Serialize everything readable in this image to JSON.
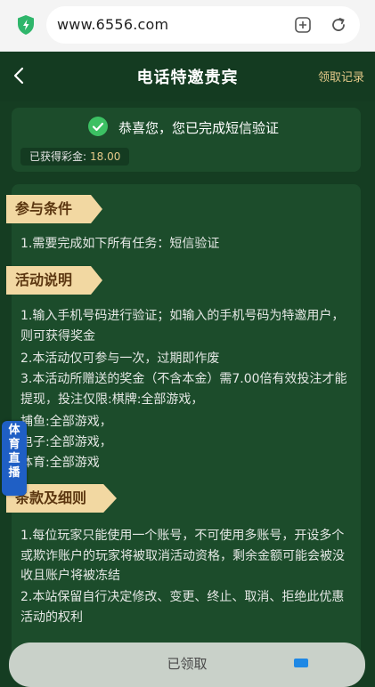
{
  "browser": {
    "url": "www.6556.com"
  },
  "header": {
    "title": "电话特邀贵宾",
    "records_link": "领取记录"
  },
  "success": {
    "message": "恭喜您，您已完成短信验证",
    "bonus_label": "已获得彩金:",
    "bonus_value": "18.00"
  },
  "sections": [
    {
      "title": "参与条件",
      "lines": [
        "1.需要完成如下所有任务：短信验证"
      ]
    },
    {
      "title": "活动说明",
      "lines": [
        "1.输入手机号码进行验证；如输入的手机号码为特邀用户，则可获得奖金",
        "2.本活动仅可参与一次，过期即作废",
        "3.本活动所赠送的奖金（不含本金）需7.00倍有效投注才能提现，投注仅限:棋牌:全部游戏，",
        "捕鱼:全部游戏，",
        "电子:全部游戏，",
        "体育:全部游戏"
      ]
    },
    {
      "title": "条款及细则",
      "lines": [
        "1.每位玩家只能使用一个账号，不可使用多账号，开设多个或欺诈账户的玩家将被取消活动资格，剩余金额可能会被没收且账户将被冻结",
        "2.本站保留自行决定修改、变更、终止、取消、拒绝此优惠活动的权利"
      ]
    }
  ],
  "side_badge": {
    "text": "体育直播"
  },
  "claim_button": {
    "label": "已领取"
  },
  "colors": {
    "background": "#153d22",
    "card": "#1c4c2b",
    "banner": "#f2d8a2",
    "accent_gold": "#e4c989",
    "check_green": "#3cc063"
  }
}
